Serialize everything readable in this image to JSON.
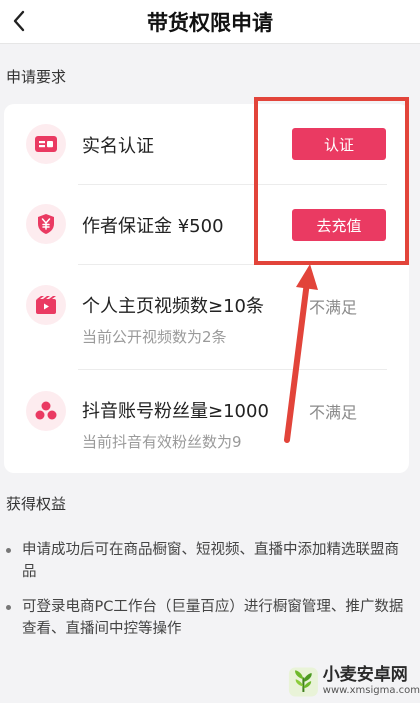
{
  "header": {
    "title": "带货权限申请"
  },
  "requirements": {
    "section_label": "申请要求",
    "items": [
      {
        "icon": "id-card-icon",
        "title": "实名认证",
        "button": "认证"
      },
      {
        "icon": "shield-yen-icon",
        "title": "作者保证金 ¥500",
        "button": "去充值"
      },
      {
        "icon": "video-icon",
        "title": "个人主页视频数≥10条",
        "status": "不满足",
        "sub": "当前公开视频数为2条"
      },
      {
        "icon": "fans-icon",
        "title": "抖音账号粉丝量≥1000",
        "status": "不满足",
        "sub": "当前抖音有效粉丝数为9"
      }
    ]
  },
  "benefits": {
    "section_label": "获得权益",
    "items": [
      "申请成功后可在商品橱窗、短视频、直播中添加精选联盟商品",
      "可登录电商PC工作台（巨量百应）进行橱窗管理、推广数据查看、直播间中控等操作"
    ]
  },
  "colors": {
    "accent": "#ea3a62",
    "annotation": "#e2443a",
    "background": "#f3f3f5"
  }
}
